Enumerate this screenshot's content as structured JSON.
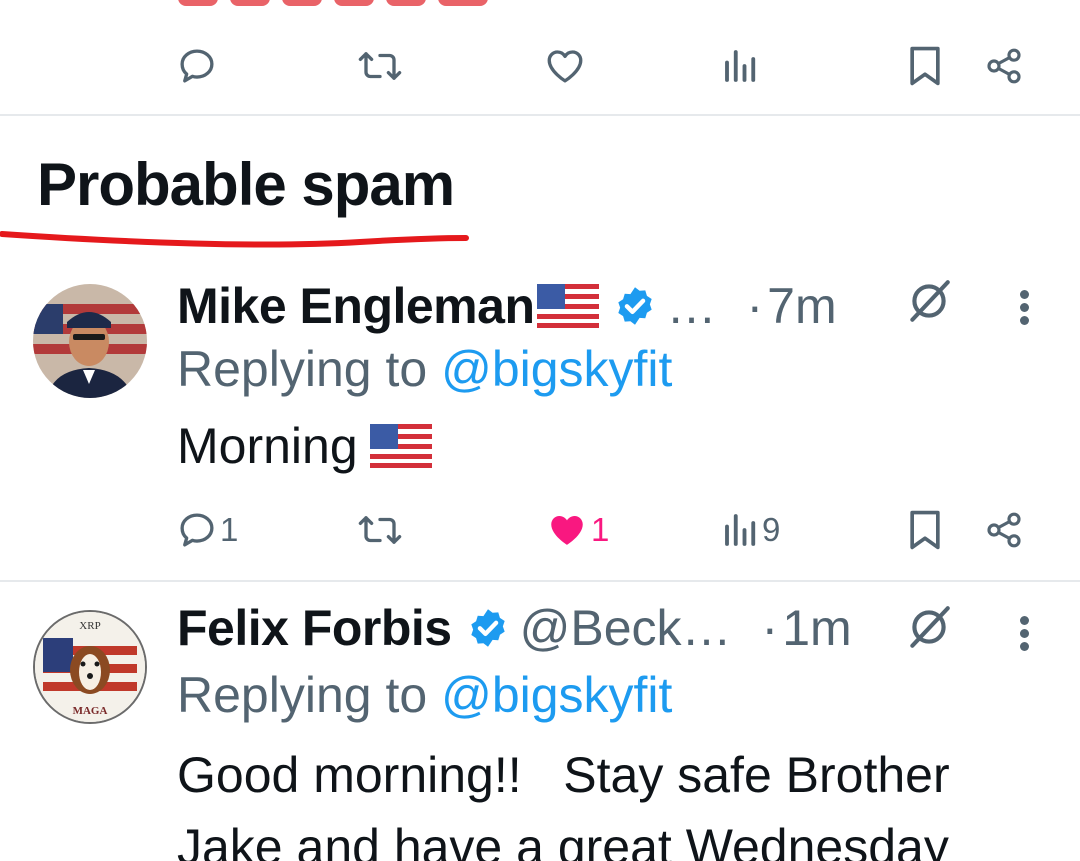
{
  "top_actions": {
    "reply_icon": "reply-icon",
    "retweet_icon": "retweet-icon",
    "like_icon": "heart-icon",
    "views_icon": "views-icon",
    "bookmark_icon": "bookmark-icon",
    "share_icon": "share-icon"
  },
  "section": {
    "heading": "Probable spam",
    "underline_color": "#e5191c"
  },
  "replies": [
    {
      "display_name": "Mike Engleman",
      "name_emoji": "us-flag",
      "verified": true,
      "handle": "…",
      "separator": "·",
      "time": "7m",
      "replying_prefix": "Replying to",
      "replying_to": "@bigskyfit",
      "text": "Morning",
      "text_emoji": "us-flag",
      "reply_count": "1",
      "retweet_count": "",
      "like_count": "1",
      "liked": true,
      "view_count": "9"
    },
    {
      "display_name": "Felix Forbis",
      "verified": true,
      "handle": "@Beck…",
      "separator": "·",
      "time": "1m",
      "replying_prefix": "Replying to",
      "replying_to": "@bigskyfit",
      "text_line1": "Good morning!!   Stay safe Brother",
      "text_line2": "Jake and have a great Wednesday",
      "avatar_labels": {
        "top": "XRP",
        "bottom": "MAGA"
      }
    }
  ],
  "colors": {
    "text_primary": "#0f1419",
    "text_secondary": "#536471",
    "link": "#1d9bf0",
    "like": "#f91880",
    "verified": "#1d9bf0",
    "divider": "#e6e9ec"
  }
}
